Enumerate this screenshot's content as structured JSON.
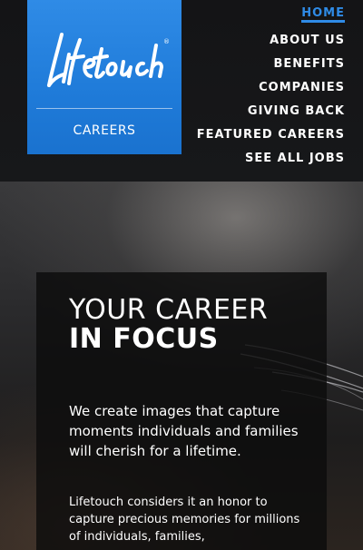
{
  "logo": {
    "brand": "Lifetouch",
    "subtitle": "CAREERS",
    "color": "#2f8be6"
  },
  "nav": {
    "items": [
      {
        "label": "HOME",
        "active": true
      },
      {
        "label": "ABOUT US",
        "active": false
      },
      {
        "label": "BENEFITS",
        "active": false
      },
      {
        "label": "COMPANIES",
        "active": false
      },
      {
        "label": "GIVING BACK",
        "active": false
      },
      {
        "label": "FEATURED CAREERS",
        "active": false
      },
      {
        "label": "SEE ALL JOBS",
        "active": false
      }
    ],
    "active_color": "#2f8be6"
  },
  "hero": {
    "title_line1": "YOUR CAREER",
    "title_line2": "IN FOCUS",
    "lead": "We create images that capture moments individuals and families will cherish for a lifetime.",
    "body": "Lifetouch considers it an honor to capture precious memories for millions of individuals, families,"
  }
}
